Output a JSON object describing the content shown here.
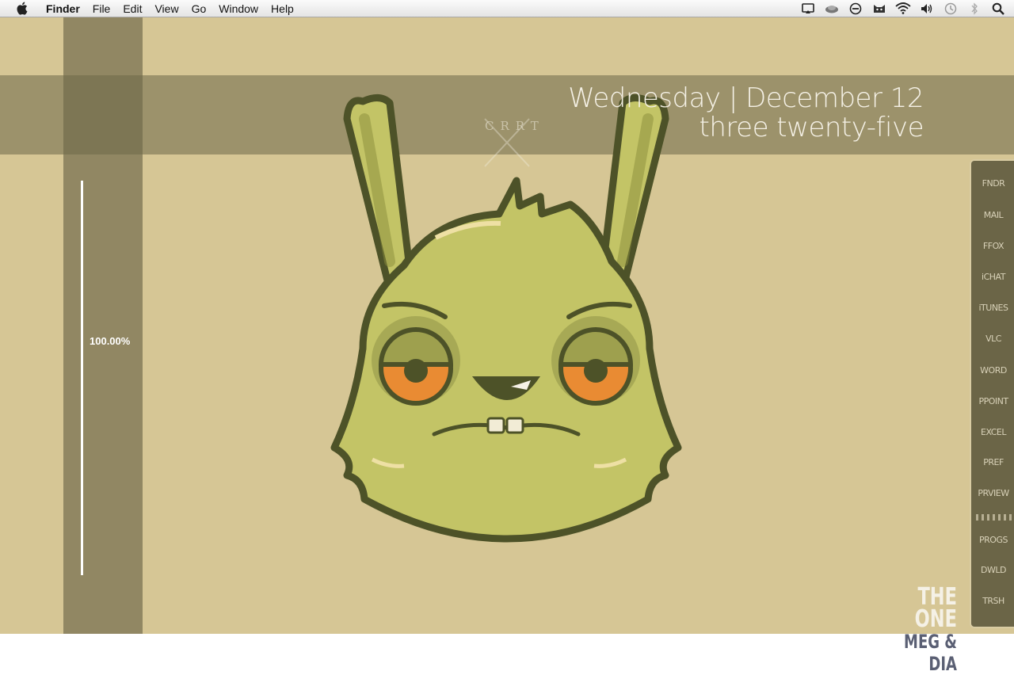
{
  "menubar": {
    "app_name": "Finder",
    "menus": [
      "File",
      "Edit",
      "View",
      "Go",
      "Window",
      "Help"
    ],
    "status_icons": [
      "airplay-icon",
      "cloud-icon",
      "no-entry-icon",
      "cat-icon",
      "wifi-icon",
      "volume-icon",
      "time-machine-icon",
      "bluetooth-icon",
      "search-icon"
    ]
  },
  "widget": {
    "date": "Wednesday | December 12",
    "time": "three twenty-five"
  },
  "slider": {
    "label": "100.00%",
    "value": 1.0
  },
  "dock": {
    "items": [
      {
        "label": "FNDR",
        "running": true
      },
      {
        "label": "MAIL",
        "running": true
      },
      {
        "label": "FFOX",
        "running": true
      },
      {
        "label": "iCHAT",
        "running": true
      },
      {
        "label": "iTUNES",
        "running": true
      },
      {
        "label": "VLC",
        "running": false
      },
      {
        "label": "WORD",
        "running": false
      },
      {
        "label": "PPOINT",
        "running": false
      },
      {
        "label": "EXCEL",
        "running": false
      },
      {
        "label": "PREF",
        "running": false
      },
      {
        "label": "PRVIEW",
        "running": true
      },
      {
        "label": "PROGS",
        "running": false
      },
      {
        "label": "DWLD",
        "running": false
      },
      {
        "label": "TRSH",
        "running": false
      }
    ]
  },
  "now_playing": {
    "line1": "THE ONE",
    "line2": "MEG & DIA"
  },
  "logo_text": "CRRT",
  "colors": {
    "wallpaper": "#d6c695",
    "rabbit": "#c3c466",
    "outline": "#4d5228"
  }
}
